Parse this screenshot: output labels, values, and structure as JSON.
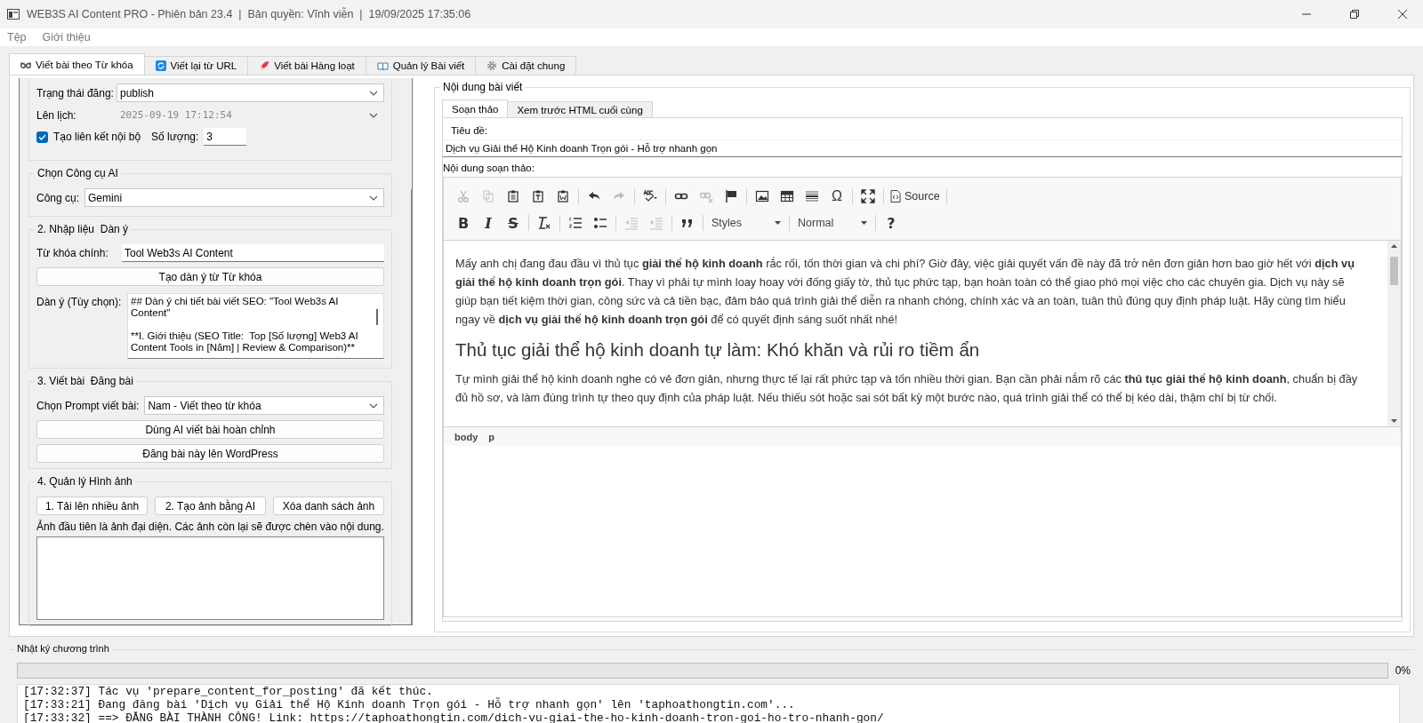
{
  "window": {
    "title": "WEB3S AI Content PRO - Phiên bản 23.4  |  Bản quyền: Vĩnh viễn  |  19/09/2025 17:35:06"
  },
  "menu": [
    "Tệp",
    "Giới thiệu"
  ],
  "tabs": [
    {
      "label": "Viết bài theo Từ khóa",
      "selected": true
    },
    {
      "label": "Viết lại từ URL",
      "selected": false
    },
    {
      "label": "Viết bài Hàng loạt",
      "selected": false
    },
    {
      "label": "Quản lý Bài viết",
      "selected": false
    },
    {
      "label": "Cài đặt chung",
      "selected": false
    }
  ],
  "left_panel": {
    "publish": {
      "status_label": "Trạng thái đăng:",
      "status": "publish",
      "schedule_label": "Lên lịch:",
      "schedule": "2025-09-19 17:12:54",
      "schedule_disabled": true,
      "internal_links_label": "Tạo liên kết nội bộ",
      "internal_links_checked": true,
      "count_label": "Số lượng:",
      "count": "3"
    },
    "ai_tool": {
      "title": "Chọn Công cụ AI",
      "label": "Công cụ:",
      "value": "Gemini"
    },
    "outline": {
      "title": "2. Nhập liệu  Dàn ý",
      "keyword_label": "Từ khóa chính:",
      "keyword": "Tool Web3s AI Content",
      "button": "Tạo dàn ý từ Từ khóa",
      "outline_label": "Dàn ý (Tùy chọn):",
      "outline_text": "## Dàn ý chi tiết bài viết SEO: \"Tool Web3s AI Content\"\n\n**I. Giới thiệu (SEO Title:  Top [Số lượng] Web3 AI Content Tools in [Năm] | Review & Comparison)**"
    },
    "write": {
      "title": "3. Viết bài  Đăng bài",
      "prompt_label": "Chọn Prompt viết bài:",
      "prompt": "Nam - Viết theo từ khóa",
      "buttons": [
        "Dùng AI viết bài hoàn chỉnh",
        "Đăng bài này lên WordPress"
      ]
    },
    "images": {
      "title": "4. Quản lý Hình ảnh",
      "buttons": [
        "1. Tải lên nhiều ảnh",
        "2. Tạo ảnh bằng AI",
        "Xóa danh sách ảnh"
      ],
      "note": "Ảnh đầu tiên là ảnh đại diện. Các ảnh còn lại sẽ được chèn vào nội dung."
    }
  },
  "content": {
    "title": "Nội dung bài viết",
    "tabs": [
      {
        "label": "Soạn thảo",
        "selected": true
      },
      {
        "label": "Xem trước HTML cuối cùng",
        "selected": false
      }
    ],
    "title_label": "Tiêu đề:",
    "post_title": "Dịch vụ Giải thể Hộ Kinh doanh Trọn gói - Hỗ trợ nhanh gọn",
    "editor_label": "Nội dung soạn thảo:",
    "toolbar_rows": [
      [
        {
          "kind": "cut",
          "disabled": true
        },
        {
          "kind": "copy",
          "disabled": true
        },
        {
          "kind": "paste",
          "disabled": false
        },
        {
          "kind": "paste-text",
          "disabled": false
        },
        {
          "kind": "paste-word",
          "disabled": false
        },
        {
          "kind": "sep"
        },
        {
          "kind": "undo",
          "disabled": false
        },
        {
          "kind": "redo",
          "disabled": true
        },
        {
          "kind": "sep"
        },
        {
          "kind": "spellcheck",
          "disabled": false
        },
        {
          "kind": "sep"
        },
        {
          "kind": "link",
          "disabled": false
        },
        {
          "kind": "unlink",
          "disabled": true
        },
        {
          "kind": "flag",
          "disabled": false
        },
        {
          "kind": "sep"
        },
        {
          "kind": "image",
          "disabled": false
        },
        {
          "kind": "table",
          "disabled": false
        },
        {
          "kind": "hr",
          "disabled": false
        },
        {
          "kind": "char",
          "text": "Ω",
          "disabled": false
        },
        {
          "kind": "sep"
        },
        {
          "kind": "maximize",
          "disabled": false
        },
        {
          "kind": "sep"
        },
        {
          "kind": "source",
          "text": "Source",
          "disabled": false
        },
        {
          "kind": "sep"
        }
      ],
      [
        {
          "kind": "bold",
          "text": "B",
          "disabled": false
        },
        {
          "kind": "italic",
          "text": "I",
          "disabled": false
        },
        {
          "kind": "strike",
          "text": "S",
          "disabled": false
        },
        {
          "kind": "sep"
        },
        {
          "kind": "clear-format",
          "disabled": false
        },
        {
          "kind": "sep"
        },
        {
          "kind": "numbered-list",
          "disabled": false
        },
        {
          "kind": "bulleted-list",
          "disabled": false
        },
        {
          "kind": "sep"
        },
        {
          "kind": "outdent",
          "disabled": true
        },
        {
          "kind": "indent",
          "disabled": true
        },
        {
          "kind": "sep"
        },
        {
          "kind": "quote",
          "disabled": false
        },
        {
          "kind": "sep"
        },
        {
          "kind": "combo",
          "text": "Styles"
        },
        {
          "kind": "sep"
        },
        {
          "kind": "combo",
          "text": "Normal"
        },
        {
          "kind": "sep"
        },
        {
          "kind": "help",
          "text": "?",
          "disabled": false
        }
      ]
    ],
    "body": [
      {
        "kind": "p",
        "text": "Mấy anh chị đang đau đầu vì thủ tục **giải thể hộ kinh doanh** rắc rối, tốn thời gian và chi phí? Giờ đây, việc giải quyết vấn đề này đã trở nên đơn giản hơn bao giờ hết với **dịch vụ giải thể hộ kinh doanh trọn gói**. Thay vì phải tự mình loay hoay với đống giấy tờ, thủ tục phức tạp, bạn hoàn toàn có thể giao phó mọi việc cho các chuyên gia. Dịch vụ này sẽ giúp bạn tiết kiệm thời gian, công sức và cả tiền bạc, đảm bảo quá trình giải thể diễn ra nhanh chóng, chính xác và an toàn, tuân thủ đúng quy định pháp luật. Hãy cùng tìm hiểu ngay về **dịch vụ giải thể hộ kinh doanh trọn gói** để có quyết định sáng suốt nhất nhé!"
      },
      {
        "kind": "h2",
        "text": "Thủ tục giải thể hộ kinh doanh tự làm: Khó khăn và rủi ro tiềm ẩn"
      },
      {
        "kind": "p",
        "text": "Tự mình giải thể hộ kinh doanh nghe có vẻ đơn giản, nhưng thực tế lại rất phức tạp và tốn nhiều thời gian. Bạn cần phải nắm rõ các **thủ tục giải thể hộ kinh doanh**, chuẩn bị đầy đủ hồ sơ, và làm đúng trình tự theo quy định của pháp luật. Nếu thiếu sót hoặc sai sót bất kỳ một bước nào, quá trình giải thể có thể bị kéo dài, thậm chí bị từ chối."
      }
    ],
    "element_path": [
      "body",
      "p"
    ]
  },
  "log": {
    "title": "Nhật ký chương trình",
    "progress": {
      "level": 0,
      "reading": "0%"
    },
    "lines": [
      "[17:32:37] Tác vụ 'prepare_content_for_posting' đã kết thúc.",
      "[17:33:21] Đang đăng bài 'Dịch vụ Giải thể Hộ Kinh doanh Trọn gói - Hỗ trợ nhanh gọn' lên 'taphoathongtin.com'...",
      "[17:33:32] ==> ĐĂNG BÀI THÀNH CÔNG! Link: https://taphoathongtin.com/dich-vu-giai-the-ho-kinh-doanh-tron-goi-ho-tro-nhanh-gon/"
    ]
  }
}
